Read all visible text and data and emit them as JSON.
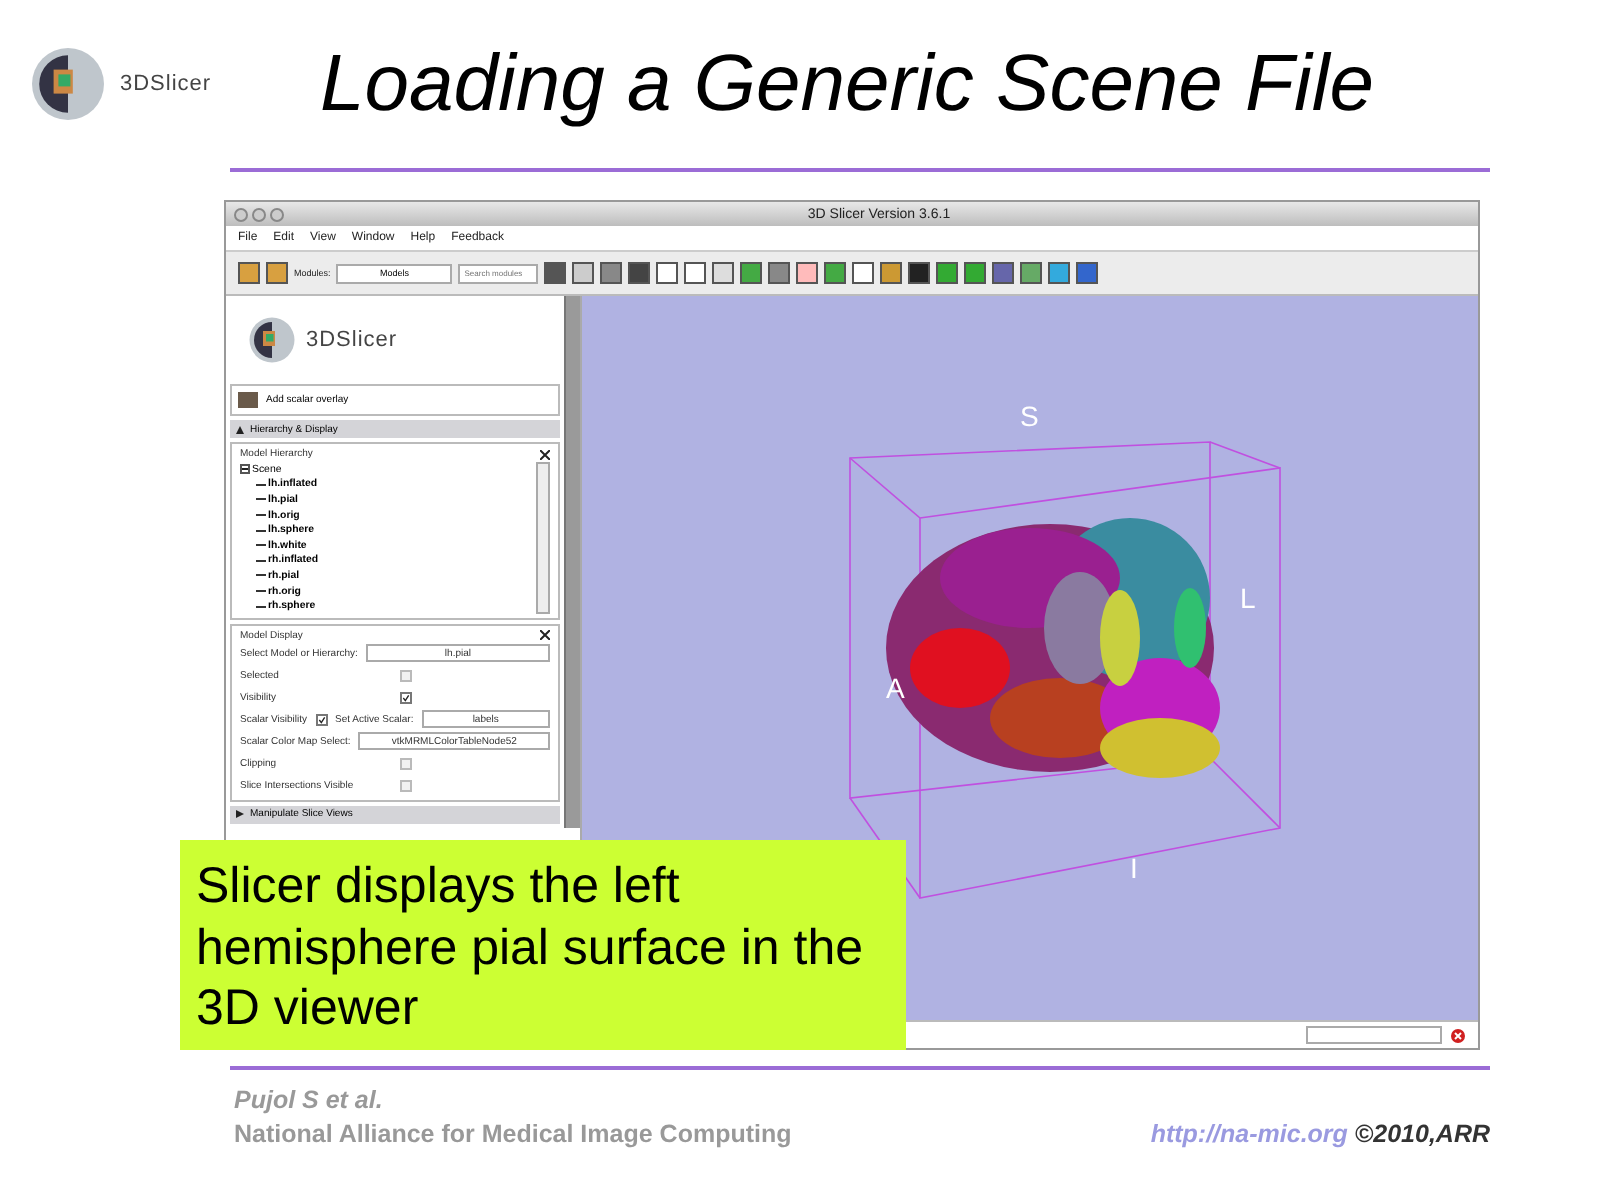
{
  "logo": {
    "text": "3DSlicer"
  },
  "title": "Loading a Generic Scene File",
  "app": {
    "window_title": "3D Slicer Version 3.6.1",
    "menu": [
      "File",
      "Edit",
      "View",
      "Window",
      "Help",
      "Feedback"
    ],
    "toolbar": {
      "modules_label": "Modules:",
      "module": "Models",
      "search_placeholder": "Search modules"
    },
    "panel": {
      "logo_text": "3DSlicer",
      "overlay_button": "Add scalar overlay",
      "section": {
        "label": "Hierarchy & Display",
        "expanded": true
      },
      "hierarchy": {
        "title": "Model Hierarchy",
        "tree": {
          "label": "Scene",
          "expanded": true,
          "children": [
            {
              "label": "lh.inflated"
            },
            {
              "label": "lh.pial"
            },
            {
              "label": "lh.orig"
            },
            {
              "label": "lh.sphere"
            },
            {
              "label": "lh.white"
            },
            {
              "label": "rh.inflated"
            },
            {
              "label": "rh.pial"
            },
            {
              "label": "rh.orig"
            },
            {
              "label": "rh.sphere"
            }
          ]
        }
      },
      "display": {
        "title": "Model Display",
        "select_label": "Select Model or Hierarchy:",
        "select_value": "lh.pial",
        "selected": {
          "label": "Selected",
          "checked": false,
          "disabled": true
        },
        "visibility": {
          "label": "Visibility",
          "checked": true,
          "disabled": false
        },
        "scalar_visibility": {
          "label": "Scalar Visibility",
          "checked": true,
          "disabled": false
        },
        "active_scalar": {
          "label": "Set Active Scalar:",
          "value": "labels"
        },
        "color_map": {
          "label": "Scalar Color Map Select:",
          "value": "vtkMRMLColorTableNode52"
        },
        "clipping": {
          "label": "Clipping",
          "checked": false,
          "disabled": true
        },
        "slice_intersections": {
          "label": "Slice Intersections Visible",
          "checked": false,
          "disabled": true
        }
      },
      "collapsed_section": {
        "label": "Manipulate Slice Views",
        "expanded": false
      }
    },
    "viewer": {
      "axis_labels": [
        "S",
        "A",
        "L",
        "I"
      ]
    }
  },
  "callout": "Slicer displays the left hemisphere pial surface in the 3D viewer",
  "footer": {
    "author": "Pujol S et al.",
    "org": "National Alliance for Medical Image Computing",
    "url": "http://na-mic.org",
    "copyright": "©2010,ARR"
  }
}
